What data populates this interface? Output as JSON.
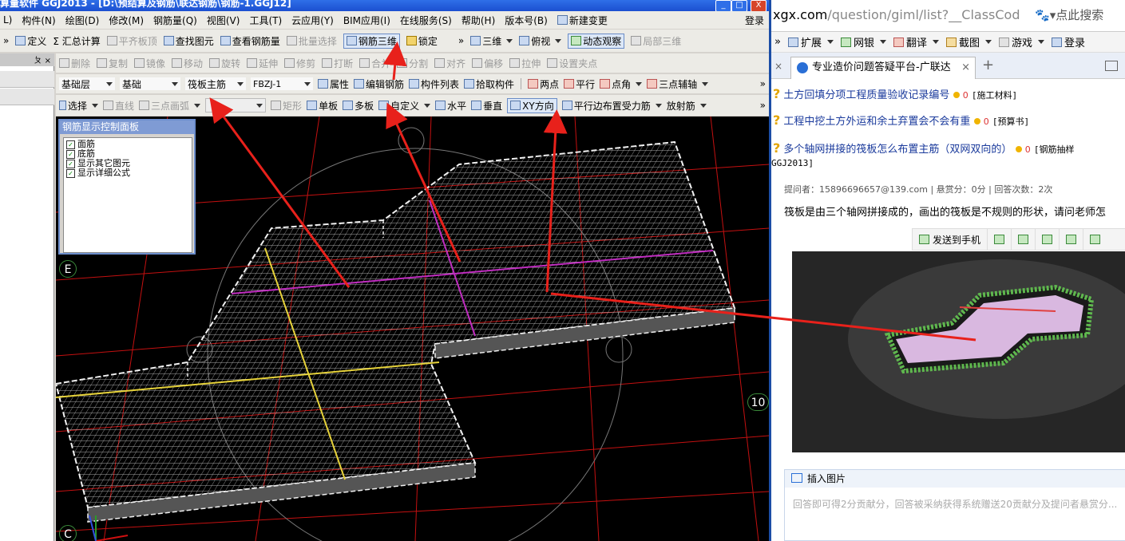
{
  "app": {
    "title": "算量软件 GGJ2013 - [D:\\预结算及钢筋\\联达钢筋\\钢筋-1.GGJ12]",
    "window_buttons": [
      "_",
      "□",
      "X"
    ],
    "menu": [
      "L)",
      "构件(N)",
      "绘图(D)",
      "修改(M)",
      "钢筋量(Q)",
      "视图(V)",
      "工具(T)",
      "云应用(Y)",
      "BIM应用(I)",
      "在线服务(S)",
      "帮助(H)",
      "版本号(B)",
      "新建变更"
    ],
    "menu_right": "登录",
    "toolbar1": {
      "overflow": "»",
      "define": "定义",
      "sum_calc": "Σ 汇总计算",
      "flush": "平齐板顶",
      "find": "查找图元",
      "view_rebar": "查看钢筋量",
      "batch_select": "批量选择",
      "rebar_3d": "钢筋三维",
      "lock": "锁定",
      "view_3d": "三维",
      "top_view": "俯视",
      "dynamic_observe": "动态观察",
      "local_3d": "局部三维"
    },
    "toolbar2": [
      "删除",
      "复制",
      "镜像",
      "移动",
      "旋转",
      "延伸",
      "修剪",
      "打断",
      "合并",
      "分割",
      "对齐",
      "偏移",
      "拉伸",
      "设置夹点"
    ],
    "toolbar3": {
      "layer": "基础层",
      "category": "基础",
      "component_type": "筏板主筋",
      "component": "FBZJ-1",
      "properties": "属性",
      "edit_rebar": "编辑钢筋",
      "component_list": "构件列表",
      "pick": "拾取构件",
      "two_points": "两点",
      "parallel": "平行",
      "point_angle": "点角",
      "three_point_aux": "三点辅轴",
      "overflow": "»"
    },
    "toolbar4": {
      "select": "选择",
      "line": "直线",
      "arc": "三点画弧",
      "rect": "矩形",
      "single": "单板",
      "multi": "多板",
      "custom": "自定义",
      "horizontal": "水平",
      "vertical": "垂直",
      "xy_dir": "XY方向",
      "parallel_edge": "平行边布置受力筋",
      "radial": "放射筋",
      "overflow": "»"
    },
    "left_panel": {
      "pin": "ㄆ ×"
    },
    "control_panel": {
      "title": "钢筋显示控制面板",
      "items": [
        "面筋",
        "底筋",
        "显示其它图元",
        "显示详细公式"
      ]
    },
    "axis_labels": {
      "e": "E",
      "c": "C",
      "ten": "10"
    }
  },
  "browser": {
    "url_main": "xgx.com",
    "url_rest": "/question/giml/list?__ClassCod",
    "search_placeholder": "点此搜索",
    "favorites": [
      "»",
      "扩展",
      "网银",
      "翻译",
      "截图",
      "游戏",
      "登录"
    ],
    "tab_title": "专业造价问题答疑平台-广联达",
    "questions": [
      {
        "title": "土方回填分项工程质量验收记录编号",
        "coins": "0",
        "tag": "[施工材料]"
      },
      {
        "title": "工程中挖土方外运和余土弃置会不会有重",
        "coins": "0",
        "tag": "[预算书]"
      },
      {
        "title": "多个轴网拼接的筏板怎么布置主筋（双网双向的）",
        "coins": "0",
        "tag": "[钢筋抽样",
        "tag2": "GGJ2013]"
      }
    ],
    "meta": "提问者：1589669665​7@139.com  |  悬赏分：0分  |  回答次数：2次",
    "body_text": "筏板是由三个轴网拼接成的，画出的筏板是不规则的形状，请问老师怎",
    "actions": {
      "send_phone": "发送到手机"
    },
    "insert_image": "插入图片",
    "answer_placeholder": "回答即可得2分贡献分，回答被采纳获得系统赠送20贡献分及提问者悬赏分..."
  },
  "colors": {
    "arrow": "#e8211b",
    "title_bar": "#1b4fd0",
    "grid_red": "#c41010",
    "wire": "#d8d8d8",
    "purple": "#c02dc0",
    "yellow": "#e6d23a"
  }
}
